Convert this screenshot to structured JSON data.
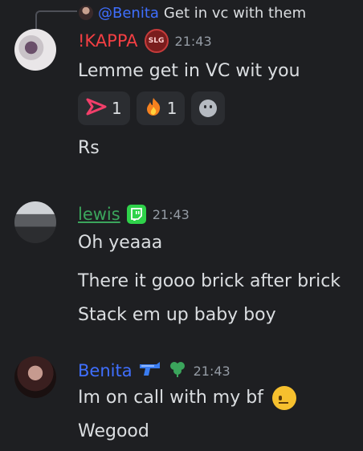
{
  "reply": {
    "name": "@Benita",
    "text": "Get in vc with them"
  },
  "messages": [
    {
      "author": "!KAPPA",
      "badge": "SLG",
      "time": "21:43",
      "lines": [
        "Lemme get in VC wit you",
        "Rs"
      ],
      "reactions": [
        {
          "icon": "arrow-emoji-icon",
          "count": "1"
        },
        {
          "icon": "fire-emoji-icon",
          "count": "1"
        }
      ]
    },
    {
      "author": "lewis",
      "badge": "twitch-icon",
      "time": "21:43",
      "lines": [
        "Oh yeaaa",
        "There it gooo brick after brick",
        "Stack em up baby boy"
      ]
    },
    {
      "author": "Benita",
      "time": "21:43",
      "lines": [
        "Im on call with my bf",
        "Wegood"
      ]
    }
  ],
  "colors": {
    "kappa": "#f23f43",
    "lewis": "#3ba55c",
    "benita": "#3f6fff",
    "background": "#1e1f22"
  }
}
